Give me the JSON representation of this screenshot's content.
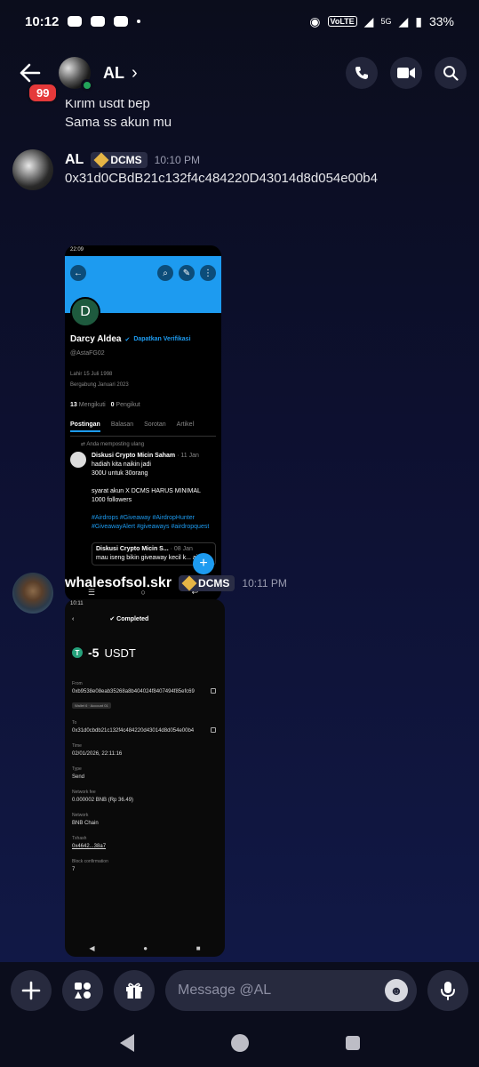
{
  "status_bar": {
    "time": "10:12",
    "network": "5G",
    "volte": "VoLTE",
    "battery": "33%"
  },
  "header": {
    "back_badge": "99",
    "name": "AL",
    "chevron": "›"
  },
  "previous_message": {
    "line1": "Kirim usdt bep",
    "line2": "Sama ss akun mu"
  },
  "messages": [
    {
      "author": "AL",
      "tag": "DCMS",
      "time": "10:10 PM",
      "text": "0x31d0CBdB21c132f4c484220D43014d8d054e00b4",
      "attachment": {
        "status_time": "22:09",
        "avatar_letter": "D",
        "profile_name": "Darcy Aldea",
        "verify_label": "Dapatkan Verifikasi",
        "handle": "@AstaFG02",
        "birth": "Lahir 15 Juli 1998",
        "joined": "Bergabung Januari 2023",
        "following_count": "13",
        "following_label": "Mengikuti",
        "followers_count": "0",
        "followers_label": "Pengikut",
        "tabs": [
          "Postingan",
          "Balasan",
          "Sorotan",
          "Artikel"
        ],
        "repost_note": "Anda memposting ulang",
        "post_author": "Diskusi Crypto Micin Saham",
        "post_date": "· 11 Jan",
        "post_lines": [
          "hadiah kita naikin jadi",
          "300U untuk 30orang",
          "",
          "syarat akun X DCMS HARUS MINIMAL",
          "1000 followers"
        ],
        "post_tags": "#Airdrops #Giveaway #AirdropHunter #GiveawayAlert #giveaways #airdropquest",
        "quote_author": "Diskusi Crypto Micin S...",
        "quote_date": "· 08 Jan",
        "quote_text": "mau iseng bikin giveaway kecil k... aja"
      }
    },
    {
      "author": "whalesofsol.skr",
      "tag": "DCMS",
      "time": "10:11 PM",
      "attachment": {
        "status_time": "10:11",
        "title": "Completed",
        "amount": "-5",
        "currency": "USDT",
        "fields": [
          {
            "label": "From",
            "value": "0xb9538e08eab35268a8b404024f8407494f85efc69",
            "extra": "Wallet 6 · Account 01",
            "copy": true
          },
          {
            "label": "To",
            "value": "0x31d0cbdb21c132f4c484220d43014d8d054e00b4",
            "copy": true
          },
          {
            "label": "Time",
            "value": "02/01/2026, 22:11:16"
          },
          {
            "label": "Type",
            "value": "Send"
          },
          {
            "label": "Network fee",
            "value": "0.000002 BNB (Rp 36.49)"
          },
          {
            "label": "Network",
            "value": "BNB Chain"
          },
          {
            "label": "Txhash",
            "value": "0x4642...38a7",
            "link": true
          },
          {
            "label": "Block confirmation",
            "value": "7"
          }
        ]
      }
    }
  ],
  "composer": {
    "placeholder": "Message @AL"
  },
  "colors": {
    "accent_blue": "#1d9bf0",
    "online_green": "#23a55a",
    "badge_red": "#e5393a",
    "tether_green": "#26a17b"
  }
}
